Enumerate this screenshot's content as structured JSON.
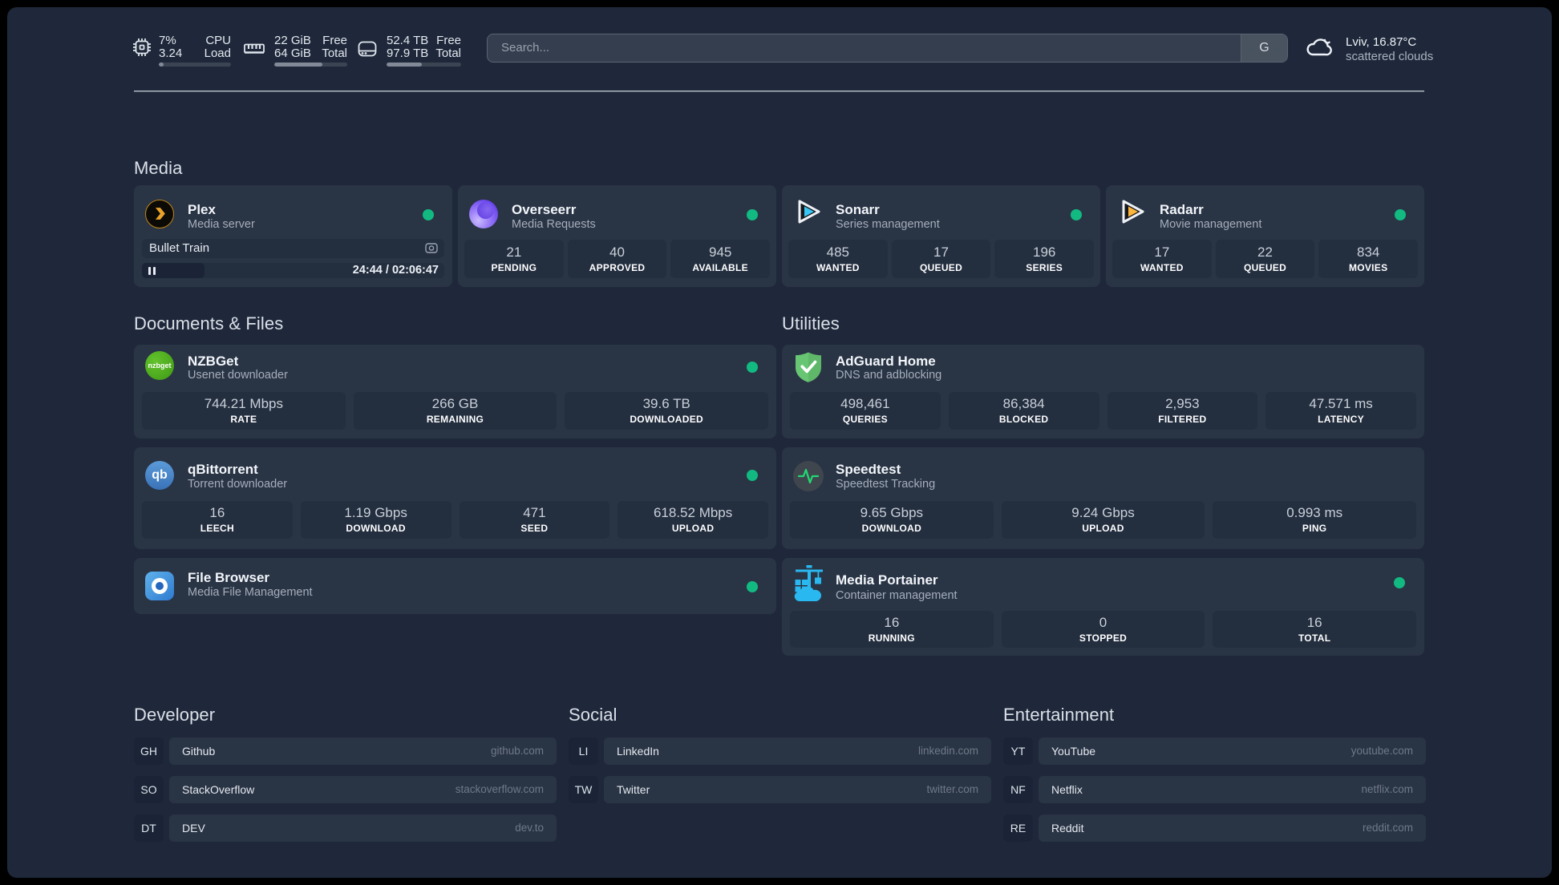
{
  "topbar": {
    "cpu": {
      "value_pct": "7%",
      "value_load": "3.24",
      "label_top": "CPU",
      "label_bottom": "Load",
      "bar_pct": 7
    },
    "memory": {
      "free": "22 GiB",
      "total": "64 GiB",
      "label_top": "Free",
      "label_bottom": "Total",
      "bar_pct": 66
    },
    "disk": {
      "free": "52.4 TB",
      "total": "97.9 TB",
      "label_top": "Free",
      "label_bottom": "Total",
      "bar_pct": 47
    },
    "search": {
      "placeholder": "Search...",
      "button_label": "G"
    },
    "weather": {
      "line1": "Lviv, 16.87°C",
      "line2": "scattered clouds"
    }
  },
  "sections": {
    "media": "Media",
    "documents": "Documents & Files",
    "utilities": "Utilities",
    "developer": "Developer",
    "social": "Social",
    "entertainment": "Entertainment"
  },
  "services": {
    "plex": {
      "name": "Plex",
      "desc": "Media server",
      "media_title": "Bullet Train",
      "elapsed_pct": 20,
      "time": "24:44 / 02:06:47"
    },
    "overseerr": {
      "name": "Overseerr",
      "desc": "Media Requests",
      "stats": [
        {
          "v": "21",
          "l": "PENDING"
        },
        {
          "v": "40",
          "l": "APPROVED"
        },
        {
          "v": "945",
          "l": "AVAILABLE"
        }
      ]
    },
    "sonarr": {
      "name": "Sonarr",
      "desc": "Series management",
      "stats": [
        {
          "v": "485",
          "l": "WANTED"
        },
        {
          "v": "17",
          "l": "QUEUED"
        },
        {
          "v": "196",
          "l": "SERIES"
        }
      ]
    },
    "radarr": {
      "name": "Radarr",
      "desc": "Movie management",
      "stats": [
        {
          "v": "17",
          "l": "WANTED"
        },
        {
          "v": "22",
          "l": "QUEUED"
        },
        {
          "v": "834",
          "l": "MOVIES"
        }
      ]
    },
    "nzbget": {
      "name": "NZBGet",
      "desc": "Usenet downloader",
      "icon_text": "nzbget",
      "stats": [
        {
          "v": "744.21 Mbps",
          "l": "RATE"
        },
        {
          "v": "266 GB",
          "l": "REMAINING"
        },
        {
          "v": "39.6 TB",
          "l": "DOWNLOADED"
        }
      ]
    },
    "qbittorrent": {
      "name": "qBittorrent",
      "desc": "Torrent downloader",
      "icon_text": "qb",
      "stats": [
        {
          "v": "16",
          "l": "LEECH"
        },
        {
          "v": "1.19 Gbps",
          "l": "DOWNLOAD"
        },
        {
          "v": "471",
          "l": "SEED"
        },
        {
          "v": "618.52 Mbps",
          "l": "UPLOAD"
        }
      ]
    },
    "filebrowser": {
      "name": "File Browser",
      "desc": "Media File Management"
    },
    "adguard": {
      "name": "AdGuard Home",
      "desc": "DNS and adblocking",
      "stats": [
        {
          "v": "498,461",
          "l": "QUERIES"
        },
        {
          "v": "86,384",
          "l": "BLOCKED"
        },
        {
          "v": "2,953",
          "l": "FILTERED"
        },
        {
          "v": "47.571 ms",
          "l": "LATENCY"
        }
      ]
    },
    "speedtest": {
      "name": "Speedtest",
      "desc": "Speedtest Tracking",
      "stats": [
        {
          "v": "9.65 Gbps",
          "l": "DOWNLOAD"
        },
        {
          "v": "9.24 Gbps",
          "l": "UPLOAD"
        },
        {
          "v": "0.993 ms",
          "l": "PING"
        }
      ]
    },
    "portainer": {
      "name": "Media Portainer",
      "desc": "Container management",
      "stats": [
        {
          "v": "16",
          "l": "RUNNING"
        },
        {
          "v": "0",
          "l": "STOPPED"
        },
        {
          "v": "16",
          "l": "TOTAL"
        }
      ]
    }
  },
  "bookmarks": {
    "developer": [
      {
        "abbr": "GH",
        "name": "Github",
        "url": "github.com"
      },
      {
        "abbr": "SO",
        "name": "StackOverflow",
        "url": "stackoverflow.com"
      },
      {
        "abbr": "DT",
        "name": "DEV",
        "url": "dev.to"
      }
    ],
    "social": [
      {
        "abbr": "LI",
        "name": "LinkedIn",
        "url": "linkedin.com"
      },
      {
        "abbr": "TW",
        "name": "Twitter",
        "url": "twitter.com"
      }
    ],
    "entertainment": [
      {
        "abbr": "YT",
        "name": "YouTube",
        "url": "youtube.com"
      },
      {
        "abbr": "NF",
        "name": "Netflix",
        "url": "netflix.com"
      },
      {
        "abbr": "RE",
        "name": "Reddit",
        "url": "reddit.com"
      }
    ]
  },
  "colors": {
    "status_online": "#12ba81",
    "background": "#1e283a",
    "card": "#293445"
  }
}
